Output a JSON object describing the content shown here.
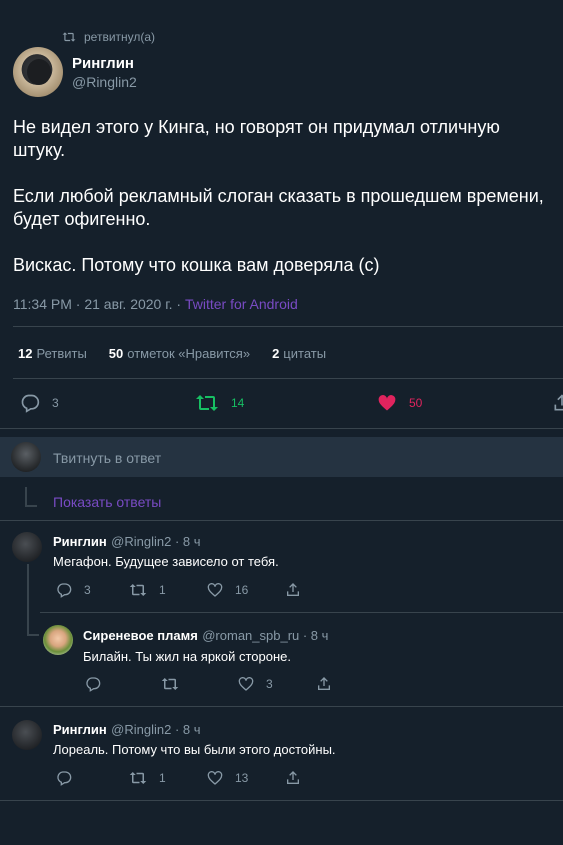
{
  "retweet_header": {
    "label": "ретвитнул(а)"
  },
  "main_tweet": {
    "name": "Ринглин",
    "handle": "@Ringlin2",
    "text": "Не видел этого у Кинга, но говорят он придумал отличную\nштуку.\n\nЕсли любой рекламный слоган сказать в прошедшем времени,\nбудет офигенно.\n\nВискас. Потому что кошка вам доверяла (с)",
    "time_date": "11:34 PM · 21 авг. 2020 г. · ",
    "source": "Twitter for Android"
  },
  "stats": {
    "retweets_count": "12",
    "retweets_label": "Ретвиты",
    "likes_count": "50",
    "likes_label": "отметок «Нравится»",
    "quotes_count": "2",
    "quotes_label": "цитаты"
  },
  "actions": {
    "reply_count": "3",
    "retweet_count": "14",
    "like_count": "50"
  },
  "reply_composer": {
    "placeholder": "Твитнуть в ответ"
  },
  "show_replies": {
    "label": "Показать ответы"
  },
  "comments": [
    {
      "name": "Ринглин",
      "handle": "@Ringlin2 · 8 ч",
      "text": "Мегафон. Будущее зависело от тебя.",
      "reply_count": "3",
      "retweet_count": "1",
      "like_count": "16"
    },
    {
      "name": "Сиреневое пламя",
      "handle": "@roman_spb_ru · 8 ч",
      "text": "Билайн. Ты жил на яркой стороне.",
      "reply_count": "",
      "retweet_count": "",
      "like_count": "3"
    },
    {
      "name": "Ринглин",
      "handle": "@Ringlin2 · 8 ч",
      "text": "Лореаль. Потому что вы были этого достойны.",
      "reply_count": "",
      "retweet_count": "1",
      "like_count": "13"
    }
  ],
  "colors": {
    "background": "#15202b",
    "muted": "#8899a6",
    "link": "#794bc4",
    "retweet_green": "#17bf63",
    "like_pink": "#e0245e",
    "divider": "#38444d"
  }
}
